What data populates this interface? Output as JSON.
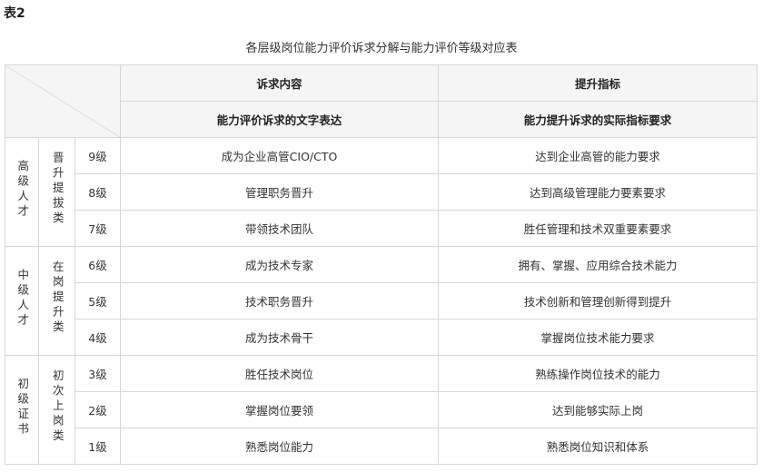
{
  "doc_label": "表2",
  "caption": "各层级岗位能力评价诉求分解与能力评价等级对应表",
  "header": {
    "col1": "诉求内容",
    "col2": "提升指标",
    "sub1": "能力评价诉求的文字表达",
    "sub2": "能力提升诉求的实际指标要求"
  },
  "groups": [
    {
      "talent": "高级人才",
      "category": "晋升提拔类",
      "rows": [
        {
          "level": "9级",
          "appeal": "成为企业高管CIO/CTO",
          "indicator": "达到企业高管的能力要求"
        },
        {
          "level": "8级",
          "appeal": "管理职务晋升",
          "indicator": "达到高级管理能力要素要求"
        },
        {
          "level": "7级",
          "appeal": "带领技术团队",
          "indicator": "胜任管理和技术双重要素要求"
        }
      ]
    },
    {
      "talent": "中级人才",
      "category": "在岗提升类",
      "rows": [
        {
          "level": "6级",
          "appeal": "成为技术专家",
          "indicator": "拥有、掌握、应用综合技术能力"
        },
        {
          "level": "5级",
          "appeal": "技术职务晋升",
          "indicator": "技术创新和管理创新得到提升"
        },
        {
          "level": "4级",
          "appeal": "成为技术骨干",
          "indicator": "掌握岗位技术能力要求"
        }
      ]
    },
    {
      "talent": "初级证书",
      "category": "初次上岗类",
      "rows": [
        {
          "level": "3级",
          "appeal": "胜任技术岗位",
          "indicator": "熟练操作岗位技术的能力"
        },
        {
          "level": "2级",
          "appeal": "掌握岗位要领",
          "indicator": "达到能够实际上岗"
        },
        {
          "level": "1级",
          "appeal": "熟悉岗位能力",
          "indicator": "熟悉岗位知识和体系"
        }
      ]
    }
  ]
}
